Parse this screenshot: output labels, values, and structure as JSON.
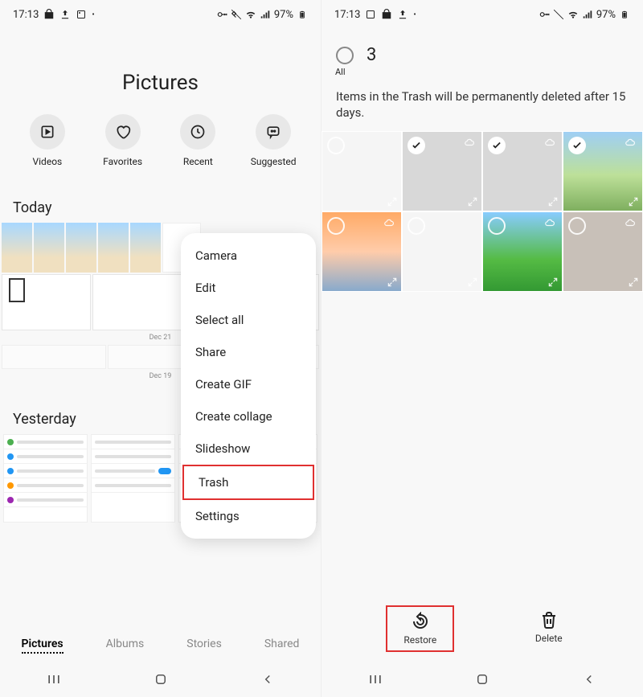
{
  "status": {
    "time": "17:13",
    "battery": "97%"
  },
  "left": {
    "title": "Pictures",
    "quick": [
      {
        "label": "Videos",
        "icon": "play-icon"
      },
      {
        "label": "Favorites",
        "icon": "heart-icon"
      },
      {
        "label": "Recent",
        "icon": "clock-icon"
      },
      {
        "label": "Suggested",
        "icon": "chat-icon"
      }
    ],
    "sections": {
      "today": "Today",
      "yesterday": "Yesterday"
    },
    "dates": {
      "d1": "Dec 21",
      "d2": "Dec 19"
    },
    "menu": [
      "Camera",
      "Edit",
      "Select all",
      "Share",
      "Create GIF",
      "Create collage",
      "Slideshow",
      "Trash",
      "Settings"
    ],
    "menu_highlight_index": 7,
    "tabs": [
      "Pictures",
      "Albums",
      "Stories",
      "Shared"
    ],
    "active_tab_index": 0
  },
  "right": {
    "all_label": "All",
    "count": "3",
    "notice": "Items in the Trash will be permanently deleted after 15 days.",
    "items": [
      {
        "checked": false,
        "variant": "whitecard",
        "cloud": false
      },
      {
        "checked": true,
        "variant": "graycard",
        "cloud": true
      },
      {
        "checked": true,
        "variant": "graycard",
        "cloud": true
      },
      {
        "checked": true,
        "variant": "landscape",
        "cloud": true
      },
      {
        "checked": false,
        "variant": "sunset",
        "cloud": true
      },
      {
        "checked": false,
        "variant": "whitecard",
        "cloud": false
      },
      {
        "checked": false,
        "variant": "field",
        "cloud": true
      },
      {
        "checked": false,
        "variant": "wall",
        "cloud": true
      }
    ],
    "actions": {
      "restore": "Restore",
      "delete": "Delete"
    }
  }
}
